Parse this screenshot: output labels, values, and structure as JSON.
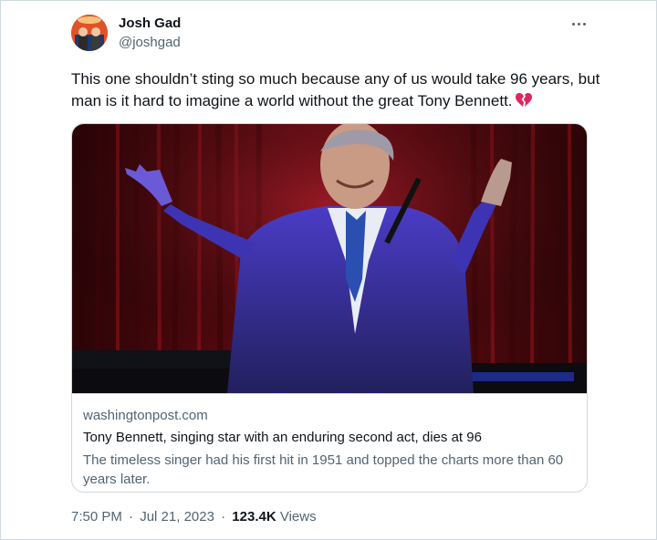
{
  "author": {
    "name": "Josh Gad",
    "handle": "@joshgad",
    "avatar": "avatar-photo"
  },
  "tweet": {
    "text": "This one shouldn’t sting so much because any of us would take 96 years, but man is it hard to imagine a world without the great Tony Bennett.",
    "emoji": "broken-heart-icon"
  },
  "card": {
    "image": "tony-bennett-on-stage-photo",
    "domain": "washingtonpost.com",
    "title": "Tony Bennett, singing star with an enduring second act, dies at 96",
    "description": "The timeless singer had his first hit in 1951 and topped the charts more than 60 years later."
  },
  "meta": {
    "time": "7:50 PM",
    "separator": "·",
    "date": "Jul 21, 2023",
    "views_count": "123.4K",
    "views_label": "Views"
  },
  "colors": {
    "text_primary": "#0f1419",
    "text_secondary": "#536471",
    "border": "#cfd9de",
    "heart": "#f91880"
  }
}
